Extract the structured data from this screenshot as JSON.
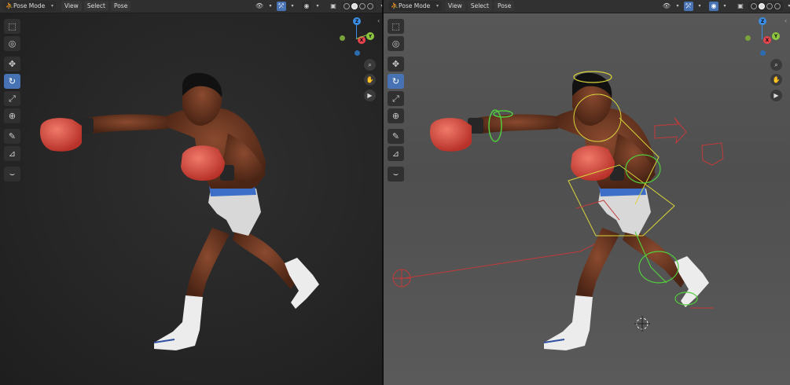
{
  "viewports": [
    {
      "id": "left",
      "header": {
        "mode": "Pose Mode",
        "menus": [
          "View",
          "Select",
          "Pose"
        ]
      },
      "navigation": {
        "axes": [
          "Z",
          "X",
          "Y"
        ]
      }
    },
    {
      "id": "right",
      "header": {
        "mode": "Pose Mode",
        "menus": [
          "View",
          "Select",
          "Pose"
        ]
      },
      "navigation": {
        "axes": [
          "Z",
          "X",
          "Y"
        ]
      }
    }
  ],
  "toolbar": {
    "tools": [
      {
        "icon": "select-box-icon",
        "glyph": "⬚",
        "active": false
      },
      {
        "icon": "cursor-icon",
        "glyph": "◎",
        "active": false
      },
      {
        "icon": "move-icon",
        "glyph": "✥",
        "active": false
      },
      {
        "icon": "rotate-icon",
        "glyph": "↻",
        "active": true
      },
      {
        "icon": "scale-icon",
        "glyph": "⤢",
        "active": false
      },
      {
        "icon": "transform-icon",
        "glyph": "⊕",
        "active": false
      },
      {
        "icon": "annotate-icon",
        "glyph": "✎",
        "active": false
      },
      {
        "icon": "measure-icon",
        "glyph": "📐",
        "active": false
      },
      {
        "icon": "relax-icon",
        "glyph": "⌣",
        "active": false
      }
    ]
  },
  "colors": {
    "accent": "#4772b3",
    "axis_x": "#e8444e",
    "axis_y": "#8ec63f",
    "axis_z": "#3a8ee6",
    "glove": "#d8473a",
    "skin": "#6e3b26",
    "rig_yellow": "#d8d43a",
    "rig_green": "#52cc3c",
    "rig_red": "#c23a3a"
  }
}
